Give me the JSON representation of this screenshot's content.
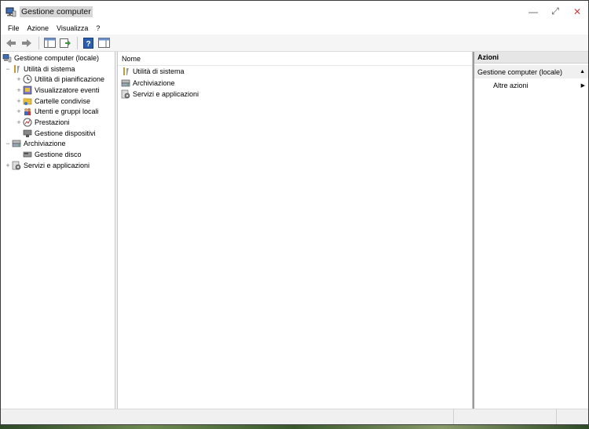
{
  "window": {
    "title": "Gestione computer",
    "controls": {
      "minimize": "—",
      "maximize": "⤢",
      "close": "✕"
    }
  },
  "menu": [
    "File",
    "Azione",
    "Visualizza",
    "?"
  ],
  "tree": {
    "root": "Gestione computer (locale)",
    "items": [
      {
        "label": "Utilità di sistema",
        "expander": "−",
        "icon": "tools-icon",
        "level": 1
      },
      {
        "label": "Utilità di pianificazione",
        "expander": "+",
        "icon": "clock-icon",
        "level": 2
      },
      {
        "label": "Visualizzatore eventi",
        "expander": "+",
        "icon": "event-viewer-icon",
        "level": 2
      },
      {
        "label": "Cartelle condivise",
        "expander": "+",
        "icon": "shared-folder-icon",
        "level": 2
      },
      {
        "label": "Utenti e gruppi locali",
        "expander": "+",
        "icon": "users-icon",
        "level": 2
      },
      {
        "label": "Prestazioni",
        "expander": "+",
        "icon": "performance-icon",
        "level": 2
      },
      {
        "label": "Gestione dispositivi",
        "expander": "",
        "icon": "device-manager-icon",
        "level": 2
      },
      {
        "label": "Archiviazione",
        "expander": "−",
        "icon": "storage-icon",
        "level": 1
      },
      {
        "label": "Gestione disco",
        "expander": "",
        "icon": "disk-icon",
        "level": 2
      },
      {
        "label": "Servizi e applicazioni",
        "expander": "+",
        "icon": "services-icon",
        "level": 1
      }
    ]
  },
  "list": {
    "column": "Nome",
    "rows": [
      {
        "label": "Utilità di sistema",
        "icon": "tools-icon"
      },
      {
        "label": "Archiviazione",
        "icon": "storage-icon"
      },
      {
        "label": "Servizi e applicazioni",
        "icon": "services-icon"
      }
    ]
  },
  "actions": {
    "title": "Azioni",
    "section": "Gestione computer (locale)",
    "section_arrow": "▲",
    "item": "Altre azioni",
    "item_arrow": "▶"
  }
}
